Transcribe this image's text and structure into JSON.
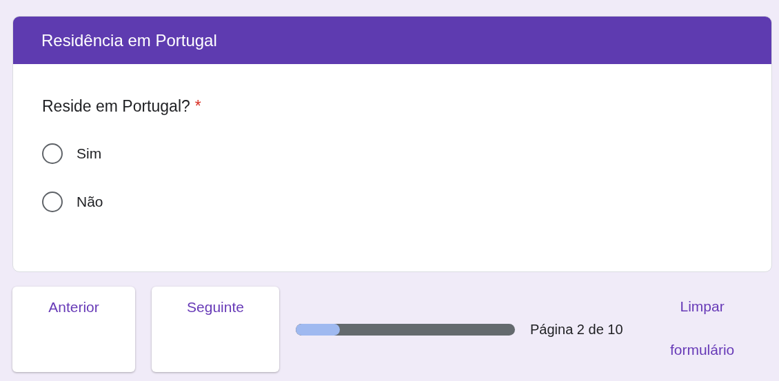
{
  "section": {
    "title": "Residência em Portugal"
  },
  "question": {
    "text": "Reside em Portugal?",
    "required": true,
    "required_mark": "*",
    "options": [
      {
        "label": "Sim",
        "selected": false
      },
      {
        "label": "Não",
        "selected": false
      }
    ]
  },
  "navigation": {
    "buttons": [
      "Anterior",
      "Seguinte"
    ],
    "progress": {
      "level": 0.2,
      "label": "Página 2 de 10"
    },
    "clear": "Limpar formulário"
  }
}
